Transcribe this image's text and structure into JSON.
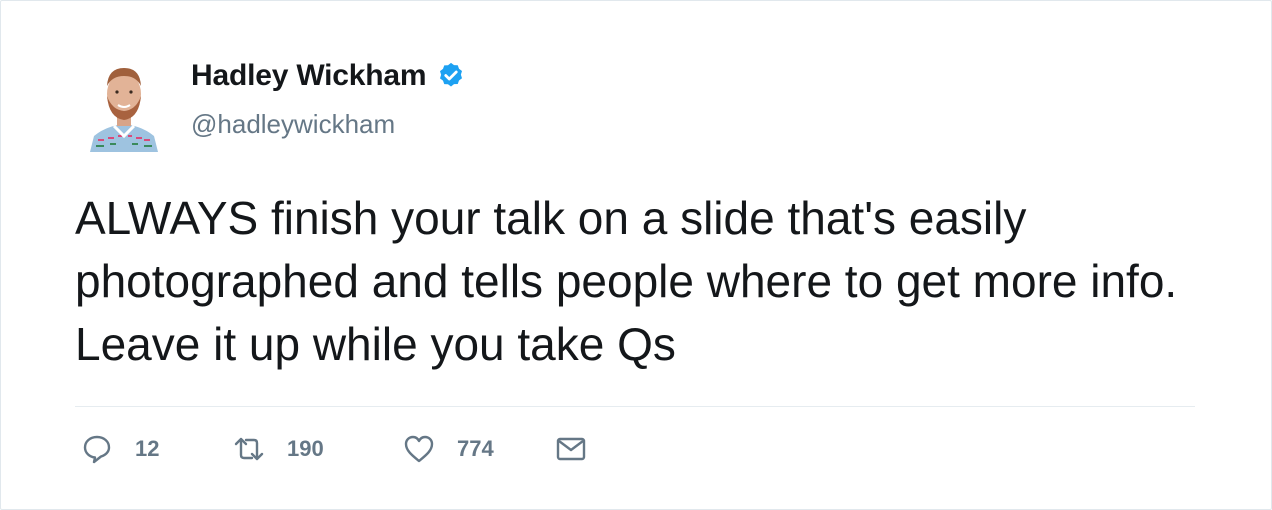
{
  "author": {
    "name": "Hadley Wickham",
    "handle": "@hadleywickham",
    "verified_icon": "verified-badge-icon"
  },
  "tweet": {
    "text": "ALWAYS finish your talk on a slide that's easily photographed and tells people where to get more info. Leave it up while you take Qs"
  },
  "actions": {
    "reply_count": "12",
    "retweet_count": "190",
    "like_count": "774",
    "icons": [
      "reply-icon",
      "retweet-icon",
      "like-icon",
      "dm-icon"
    ]
  },
  "colors": {
    "text": "#14171a",
    "secondary": "#657786",
    "verified": "#1da1f2",
    "border": "#e1e8ed"
  }
}
